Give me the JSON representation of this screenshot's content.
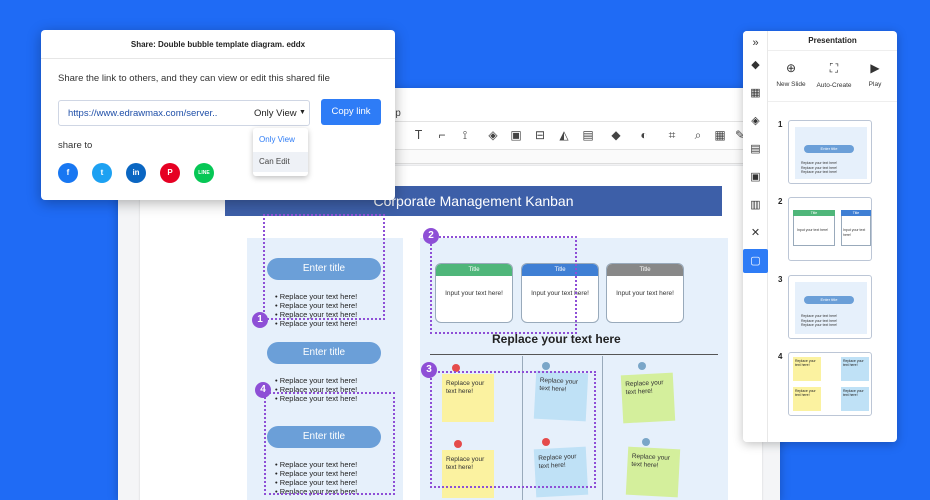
{
  "share_dialog": {
    "title": "Share: Double bubble template diagram. eddx",
    "description": "Share the link to others, and they can view or edit this shared file",
    "link_url": "https://www.edrawmax.com/server..",
    "permission": "Only View",
    "copy_label": "Copy link",
    "options": [
      "Only View",
      "Can Edit"
    ],
    "share_to_label": "share to",
    "social": [
      {
        "label": "f",
        "color": "#1877f2"
      },
      {
        "label": "t",
        "color": "#1da1f2"
      },
      {
        "label": "in",
        "color": "#0a66c2"
      },
      {
        "label": "P",
        "color": "#e60023"
      },
      {
        "label": "LINE",
        "color": "#06c755"
      }
    ]
  },
  "editor": {
    "menu_partial": "lp",
    "diagram": {
      "title": "Corporate Management Kanban",
      "left_pills": [
        "Enter title",
        "Enter title",
        "Enter title"
      ],
      "bullet": "Replace your text here!",
      "cards": [
        {
          "head": "Title",
          "body": "Input your text here!",
          "color": "#4fb67a"
        },
        {
          "head": "Title",
          "body": "Input your text here!",
          "color": "#3f7fd4"
        },
        {
          "head": "Title",
          "body": "Input your text here!",
          "color": "#888888"
        }
      ],
      "subtitle": "Replace your text here",
      "note_text": "Replace your text here!",
      "badges": [
        "1",
        "2",
        "3",
        "4"
      ]
    }
  },
  "presentation": {
    "title": "Presentation",
    "actions": [
      {
        "label": "New Slide",
        "icon": "⊕"
      },
      {
        "label": "Auto-Create",
        "icon": "⛶"
      },
      {
        "label": "Play",
        "icon": "▶"
      }
    ],
    "slide_numbers": [
      "1",
      "2",
      "3",
      "4"
    ],
    "thumb_pill": "Enter title",
    "thumb_bullet": "Replace your text here!",
    "thumb_card_head": "Title",
    "thumb_card_body": "Input your text here!",
    "thumb_note": "Replace your text here!"
  },
  "colors": {
    "background": "#1f6bf5",
    "accent": "#2e7cf6",
    "selection": "#8e4fd6",
    "kanban_header": "#3d5fa8",
    "note_yellow": "#fbf2a0",
    "note_blue": "#bfe1f6",
    "note_green": "#d4ef9c"
  }
}
